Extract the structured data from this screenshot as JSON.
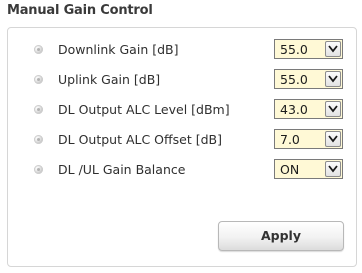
{
  "section_title": "Manual Gain Control",
  "rows": [
    {
      "label": "Downlink Gain [dB]",
      "value": "55.0"
    },
    {
      "label": "Uplink Gain [dB]",
      "value": "55.0"
    },
    {
      "label": "DL Output ALC Level [dBm]",
      "value": "43.0"
    },
    {
      "label": "DL Output ALC Offset [dB]",
      "value": "7.0"
    },
    {
      "label": "DL /UL Gain Balance",
      "value": "ON"
    }
  ],
  "apply_label": "Apply",
  "icons": {
    "row_bullet": "bullet-icon",
    "select_arrow": "chevron-down-icon"
  },
  "colors": {
    "select_background": "#fff9d6",
    "panel_border": "#d6d6d6"
  }
}
